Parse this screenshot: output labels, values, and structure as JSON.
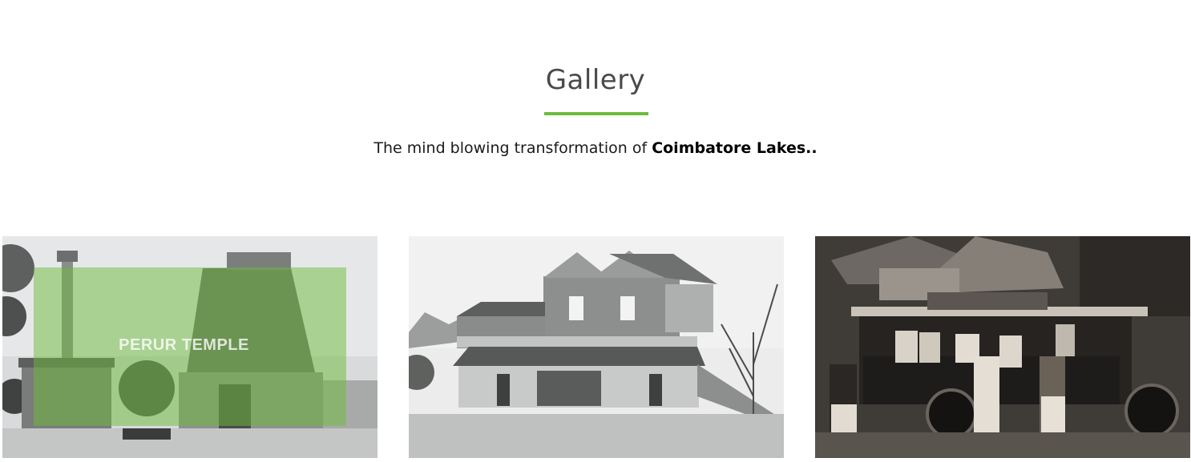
{
  "gallery": {
    "title": "Gallery",
    "subtitle_prefix": "The mind blowing transformation of ",
    "subtitle_bold": "Coimbatore Lakes..",
    "accent_color": "#6cbc3a",
    "items": [
      {
        "caption": "PERUR TEMPLE",
        "image": "temple-photo"
      },
      {
        "caption": "",
        "image": "colonial-building-photo"
      },
      {
        "caption": "",
        "image": "vintage-bus-photo"
      }
    ]
  }
}
